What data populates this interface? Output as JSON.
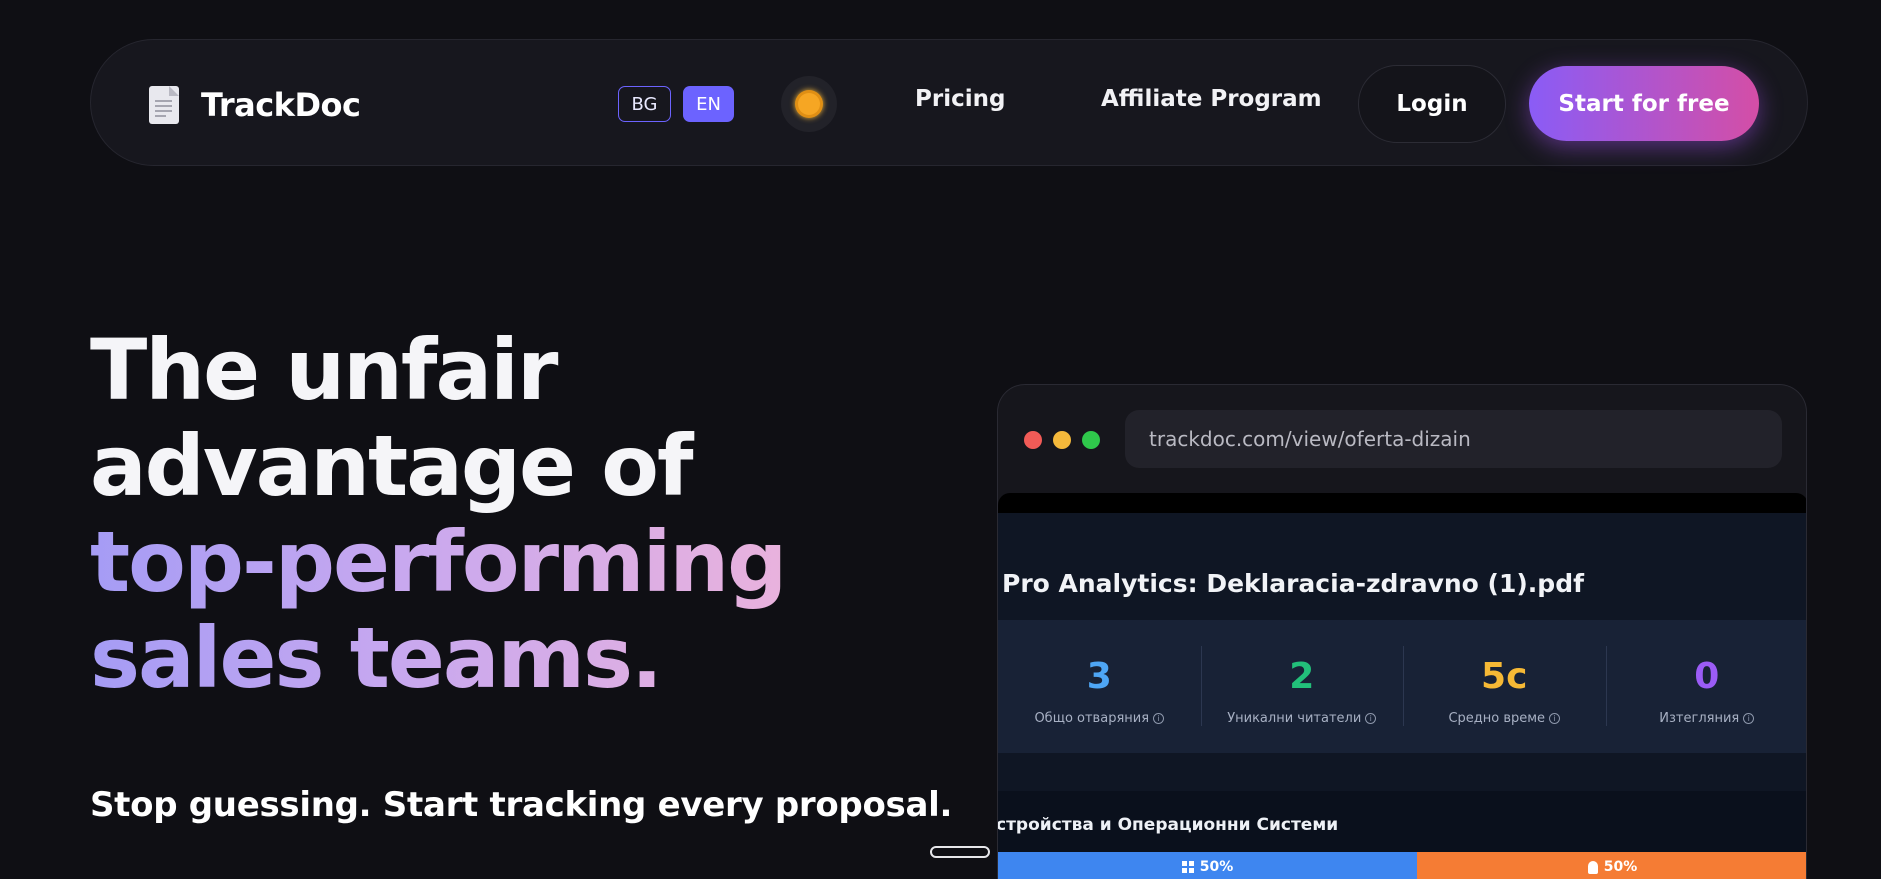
{
  "nav": {
    "logo_text": "TrackDoc",
    "lang_bg": "BG",
    "lang_en": "EN",
    "pricing": "Pricing",
    "affiliate": "Affiliate Program",
    "login": "Login",
    "start": "Start for free"
  },
  "hero": {
    "line1": "The unfair",
    "line2": "advantage of",
    "line3": "top-performing",
    "line4": "sales teams.",
    "subtitle": "Stop guessing. Start tracking every proposal."
  },
  "browser": {
    "url": "trackdoc.com/view/oferta-dizain",
    "title": "Pro Analytics: Deklaracia-zdravno (1).pdf",
    "stats": [
      {
        "value": "3",
        "label": "Общо отваряния",
        "color": "#4ea6f5"
      },
      {
        "value": "2",
        "label": "Уникални читатели",
        "color": "#22c07a"
      },
      {
        "value": "5с",
        "label": "Средно време",
        "color": "#f6b935"
      },
      {
        "value": "0",
        "label": "Изтегляния",
        "color": "#9b5cf6"
      }
    ],
    "section_title": "стройства и Операционни Системи",
    "bar_windows": "50%",
    "bar_android": "50%"
  },
  "colors": {
    "accent": "#6c63ff",
    "cta_start": "#8a5cf6",
    "cta_end": "#d44ea6",
    "dot_red": "#f25b57",
    "dot_yellow": "#f5b93b",
    "dot_green": "#2fc84b"
  }
}
